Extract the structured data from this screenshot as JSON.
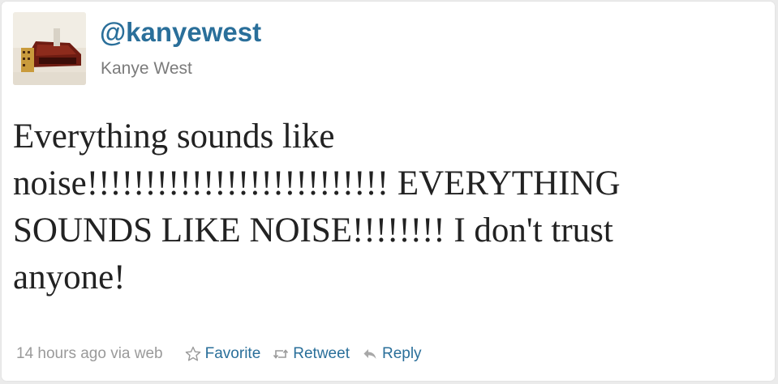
{
  "tweet": {
    "handle": "@kanyewest",
    "display_name": "Kanye West",
    "text_lines": [
      "Everything sounds like",
      "noise!!!!!!!!!!!!!!!!!!!!!!!!!! EVERYTHING",
      "SOUNDS LIKE NOISE!!!!!!!! I don't trust",
      "anyone!"
    ],
    "timestamp": "14 hours ago via web",
    "actions": {
      "favorite_label": "Favorite",
      "retweet_label": "Retweet",
      "reply_label": "Reply"
    }
  },
  "colors": {
    "link_blue": "#2a6f9a",
    "muted_gray": "#9a9a9a",
    "text_dark": "#222222"
  },
  "icons": {
    "favorite": "star-icon",
    "retweet": "retweet-icon",
    "reply": "reply-icon"
  }
}
